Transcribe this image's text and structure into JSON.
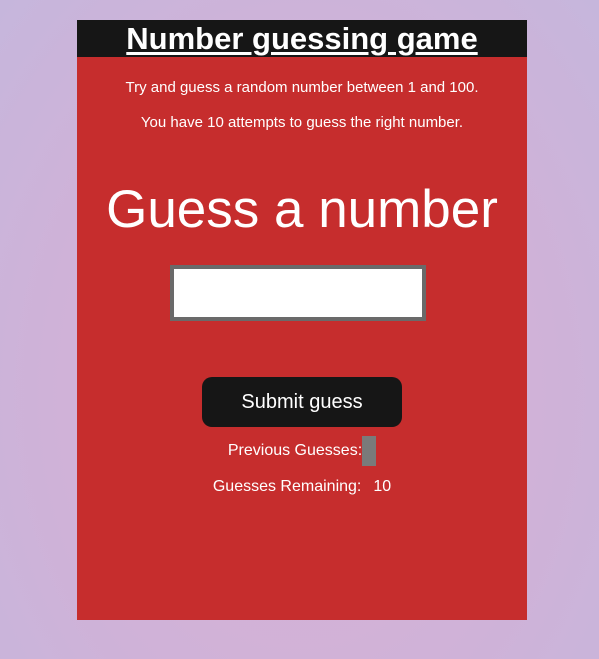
{
  "game": {
    "title": "Number guessing game",
    "intro_line_1": "Try and guess a random number between 1 and 100.",
    "intro_line_2": "You have 10 attempts to guess the right number.",
    "heading": "Guess a number",
    "input_value": "",
    "submit_label": "Submit guess",
    "previous_label": "Previous Guesses:",
    "previous_value": "",
    "remaining_label": "Guesses Remaining:",
    "remaining_value": "10"
  },
  "colors": {
    "panel": "#c62d2d",
    "title_bar": "#161616",
    "button": "#161616",
    "input_border": "#6a6a6a"
  }
}
